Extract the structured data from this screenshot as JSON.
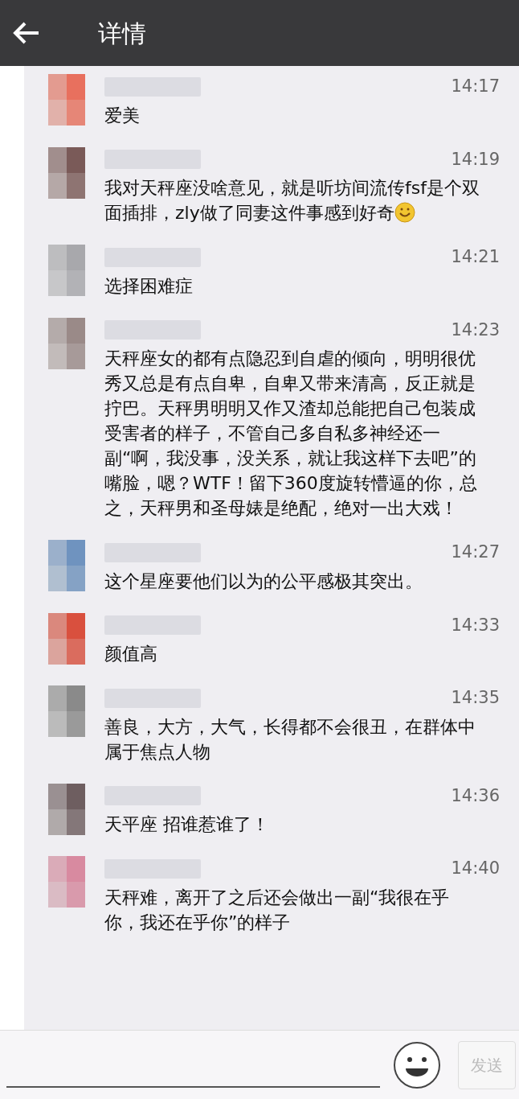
{
  "header": {
    "title": "详情"
  },
  "messages": [
    {
      "time": "14:17",
      "text": "爱美",
      "color": "#e8705e"
    },
    {
      "time": "14:19",
      "text": "我对天秤座没啥意见，就是听坊间流传fsf是个双面插排，zly做了同妻这件事感到好奇",
      "has_emoji": true,
      "color": "#7a5a58"
    },
    {
      "time": "14:21",
      "text": "选择困难症",
      "color": "#a8a8ac"
    },
    {
      "time": "14:23",
      "text": "天秤座女的都有点隐忍到自虐的倾向，明明很优秀又总是有点自卑，自卑又带来清高，反正就是拧巴。天秤男明明又作又渣却总能把自己包装成受害者的样子，不管自己多自私多神经还一副“啊，我没事，没关系，就让我这样下去吧”的嘴脸，嗯？WTF！留下360度旋转懵逼的你，总之，天秤男和圣母婊是绝配，绝对一出大戏！",
      "color": "#9a8a88"
    },
    {
      "time": "14:27",
      "text": "这个星座要他们以为的公平感极其突出。",
      "color": "#6f93bf"
    },
    {
      "time": "14:33",
      "text": "颜值高",
      "color": "#d9503e"
    },
    {
      "time": "14:35",
      "text": "善良，大方，大气，长得都不会很丑，在群体中属于焦点人物",
      "color": "#8a8a8a"
    },
    {
      "time": "14:36",
      "text": "天平座 招谁惹谁了！",
      "color": "#6e5e60"
    },
    {
      "time": "14:40",
      "text": "天秤难，离开了之后还会做出一副“我很在乎你，我还在乎你”的样子",
      "color": "#d88aa0"
    }
  ],
  "composer": {
    "send_label": "发送",
    "send_disabled": true
  }
}
